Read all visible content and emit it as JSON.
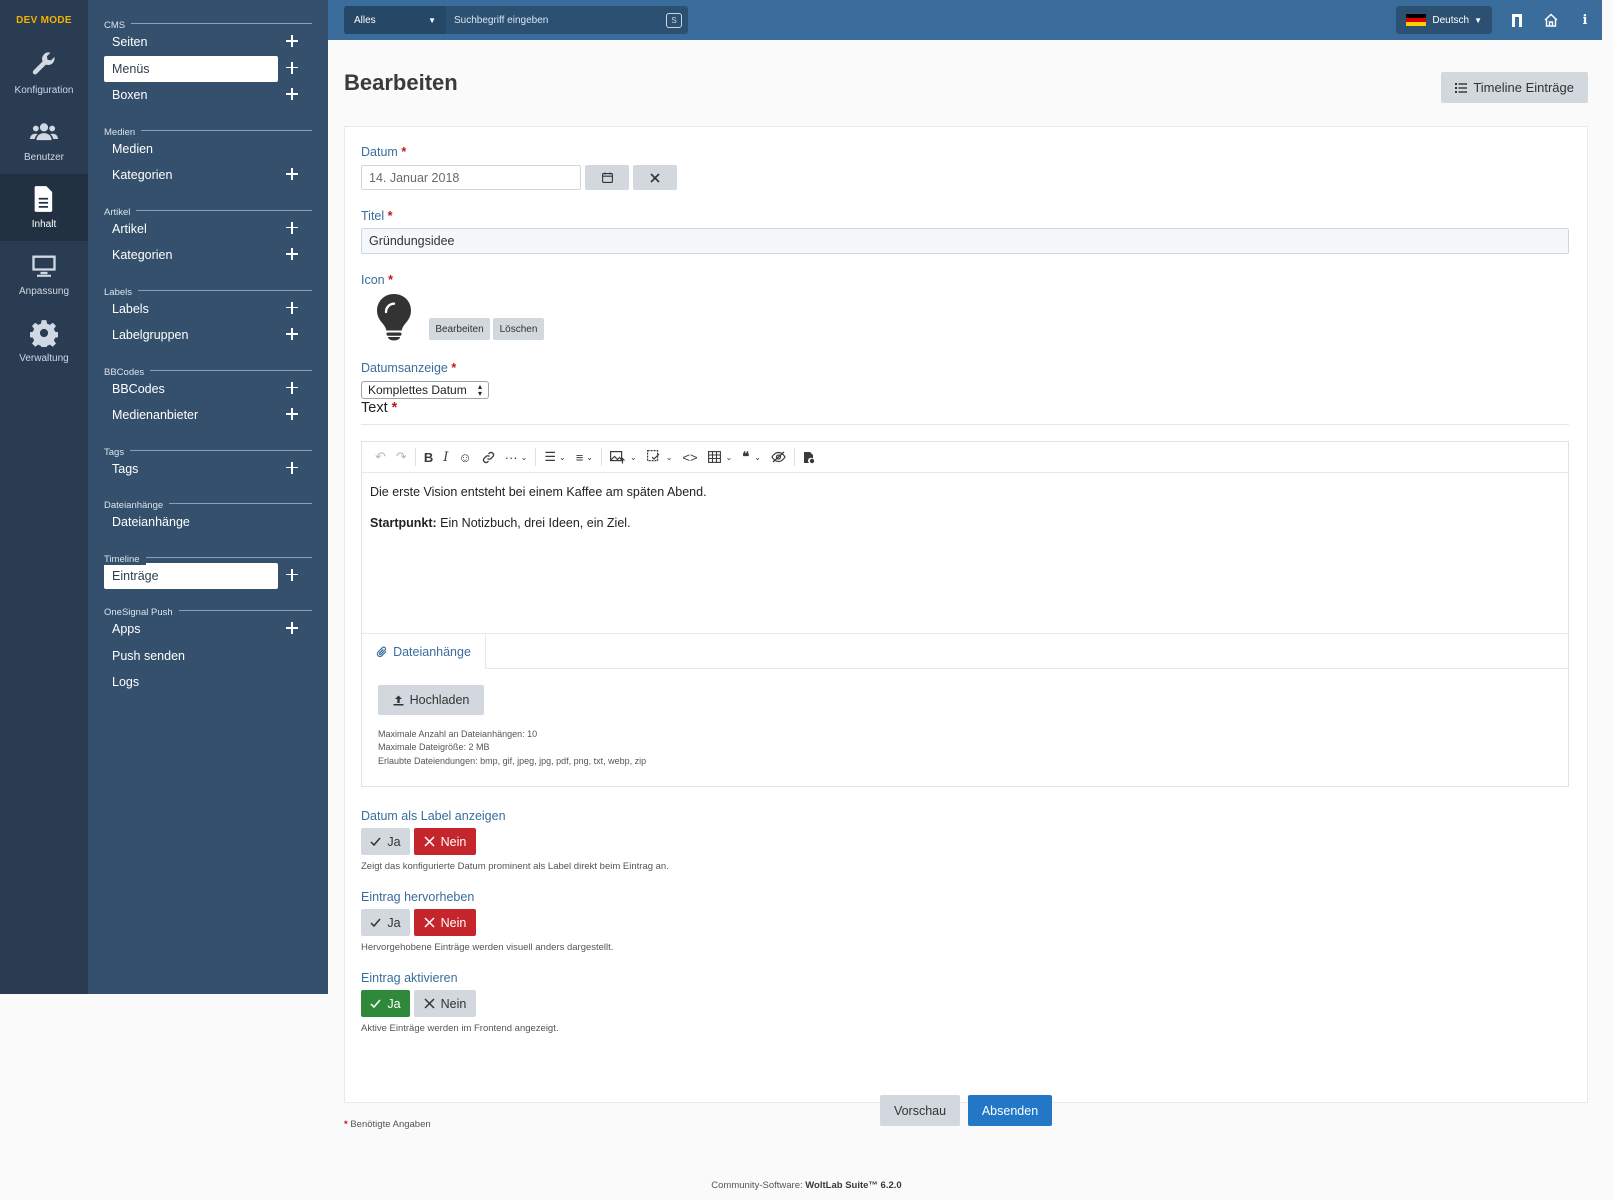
{
  "app": {
    "dev_mode": "DEV MODE"
  },
  "iconbar": [
    {
      "label": "Konfiguration",
      "icon": "wrench-icon"
    },
    {
      "label": "Benutzer",
      "icon": "users-icon"
    },
    {
      "label": "Inhalt",
      "icon": "file-icon",
      "active": true
    },
    {
      "label": "Anpassung",
      "icon": "monitor-icon"
    },
    {
      "label": "Verwaltung",
      "icon": "gear-icon"
    }
  ],
  "subnav": [
    {
      "section": "CMS",
      "items": [
        {
          "label": "Seiten",
          "plus": true
        },
        {
          "label": "Menüs",
          "plus": true,
          "active": true
        },
        {
          "label": "Boxen",
          "plus": true
        }
      ]
    },
    {
      "section": "Medien",
      "items": [
        {
          "label": "Medien",
          "plus": false
        },
        {
          "label": "Kategorien",
          "plus": true
        }
      ]
    },
    {
      "section": "Artikel",
      "items": [
        {
          "label": "Artikel",
          "plus": true
        },
        {
          "label": "Kategorien",
          "plus": true
        }
      ]
    },
    {
      "section": "Labels",
      "items": [
        {
          "label": "Labels",
          "plus": true
        },
        {
          "label": "Labelgruppen",
          "plus": true
        }
      ]
    },
    {
      "section": "BBCodes",
      "items": [
        {
          "label": "BBCodes",
          "plus": true
        },
        {
          "label": "Medienanbieter",
          "plus": true
        }
      ]
    },
    {
      "section": "Tags",
      "items": [
        {
          "label": "Tags",
          "plus": true
        }
      ]
    },
    {
      "section": "Dateianhänge",
      "items": [
        {
          "label": "Dateianhänge",
          "plus": false
        }
      ]
    },
    {
      "section": "Timeline",
      "items": [
        {
          "label": "Einträge",
          "plus": true,
          "active": true
        }
      ]
    },
    {
      "section": "OneSignal Push",
      "items": [
        {
          "label": "Apps",
          "plus": true
        },
        {
          "label": "Push senden",
          "plus": false
        },
        {
          "label": "Logs",
          "plus": false
        }
      ]
    }
  ],
  "topbar": {
    "search_scope": "Alles",
    "search_placeholder": "Suchbegriff eingeben",
    "search_shortcut": "S",
    "language": "Deutsch"
  },
  "page": {
    "title": "Bearbeiten",
    "timeline_button": "Timeline Einträge"
  },
  "form": {
    "date_label": "Datum",
    "date_value": "14. Januar 2018",
    "title_label": "Titel",
    "title_value": "Gründungsidee",
    "icon_label": "Icon",
    "icon_edit": "Bearbeiten",
    "icon_delete": "Löschen",
    "date_display_label": "Datumsanzeige",
    "date_display_value": "Komplettes Datum",
    "text_label": "Text",
    "required_mark": "*",
    "editor": {
      "line1": "Die erste Vision entsteht bei einem Kaffee am späten Abend.",
      "line2_bold": "Startpunkt:",
      "line2_rest": " Ein Notizbuch, drei Ideen, ein Ziel."
    },
    "attachments_tab": "Dateianhänge",
    "upload_button": "Hochladen",
    "attach_info": [
      "Maximale Anzahl an Dateianhängen: 10",
      "Maximale Dateigröße: 2 MB",
      "Erlaubte Dateiendungen: bmp, gif, jpeg, jpg, pdf, png, txt, webp, zip"
    ],
    "toggles": [
      {
        "label": "Datum als Label anzeigen",
        "selected": "no",
        "hint": "Zeigt das konfigurierte Datum prominent als Label direkt beim Eintrag an."
      },
      {
        "label": "Eintrag hervorheben",
        "selected": "no",
        "hint": "Hervorgehobene Einträge werden visuell anders dargestellt."
      },
      {
        "label": "Eintrag aktivieren",
        "selected": "yes",
        "hint": "Aktive Einträge werden im Frontend angezeigt."
      }
    ],
    "yes_label": "Ja",
    "no_label": "Nein",
    "preview_button": "Vorschau",
    "submit_button": "Absenden"
  },
  "required_note": "Benötigte Angaben",
  "footer": {
    "prefix": "Community-Software: ",
    "product": "WoltLab Suite™ 6.2.0"
  }
}
